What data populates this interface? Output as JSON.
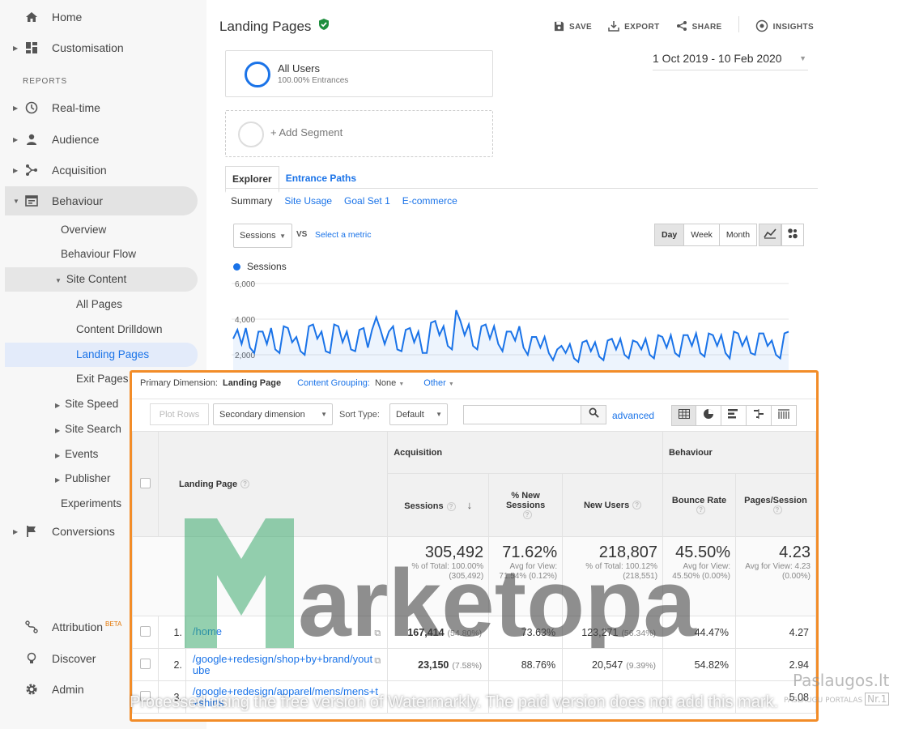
{
  "sidebar": {
    "items_top": [
      {
        "label": "Home",
        "icon": "home-icon"
      },
      {
        "label": "Customisation",
        "icon": "dashboard-icon"
      }
    ],
    "reports_label": "REPORTS",
    "items": [
      {
        "label": "Real-time",
        "icon": "clock-icon"
      },
      {
        "label": "Audience",
        "icon": "person-icon"
      },
      {
        "label": "Acquisition",
        "icon": "acquisition-icon"
      },
      {
        "label": "Behaviour",
        "icon": "behaviour-icon"
      }
    ],
    "behaviour_sub": [
      "Overview",
      "Behaviour Flow",
      "Site Content"
    ],
    "site_content_sub": [
      "All Pages",
      "Content Drilldown",
      "Landing Pages",
      "Exit Pages"
    ],
    "behaviour_more": [
      "Site Speed",
      "Site Search",
      "Events",
      "Publisher",
      "Experiments"
    ],
    "conversions": "Conversions",
    "bottom": [
      {
        "label": "Attribution",
        "badge": "BETA",
        "icon": "attribution-icon"
      },
      {
        "label": "Discover",
        "icon": "lightbulb-icon"
      },
      {
        "label": "Admin",
        "icon": "gear-icon"
      }
    ]
  },
  "header": {
    "title": "Landing Pages",
    "toolbar": {
      "save": "SAVE",
      "export": "EXPORT",
      "share": "SHARE",
      "insights": "INSIGHTS"
    }
  },
  "segments": {
    "current_name": "All Users",
    "current_sub": "100.00% Entrances",
    "add_label": "+ Add Segment"
  },
  "date_range": "1 Oct 2019 - 10 Feb 2020",
  "tabs": [
    "Explorer",
    "Entrance Paths"
  ],
  "subtabs": [
    "Summary",
    "Site Usage",
    "Goal Set 1",
    "E-commerce"
  ],
  "chart_controls": {
    "metric": "Sessions",
    "vs": "VS",
    "select_metric": "Select a metric",
    "periods": [
      "Day",
      "Week",
      "Month"
    ]
  },
  "chart_data": {
    "type": "line",
    "series": [
      {
        "name": "Sessions",
        "values": [
          2900,
          3400,
          2600,
          3500,
          2400,
          2100,
          3300,
          3300,
          2600,
          3500,
          2300,
          2100,
          3600,
          3500,
          2700,
          3000,
          2200,
          2000,
          3600,
          3700,
          2900,
          3300,
          2200,
          2100,
          3700,
          3600,
          2700,
          3300,
          2300,
          2200,
          3400,
          3500,
          2400,
          3400,
          4100,
          3400,
          2600,
          3300,
          3600,
          2300,
          2200,
          3400,
          3500,
          2700,
          3300,
          2100,
          2100,
          3800,
          3900,
          3100,
          3600,
          2500,
          2300,
          4500,
          3900,
          3100,
          3700,
          2500,
          2300,
          3600,
          3700,
          2900,
          3600,
          2600,
          2200,
          3300,
          3300,
          2800,
          3600,
          2400,
          2000,
          3000,
          3000,
          2400,
          3000,
          2100,
          1700,
          2300,
          2500,
          2100,
          2600,
          1800,
          1600,
          2700,
          2800,
          2200,
          2700,
          1900,
          1700,
          2800,
          2900,
          2300,
          2900,
          2000,
          1800,
          2800,
          2700,
          2300,
          2900,
          2000,
          1800,
          3100,
          3000,
          2400,
          3100,
          2100,
          1900,
          3100,
          3100,
          2500,
          3200,
          2100,
          1900,
          3200,
          3100,
          2500,
          3100,
          2100,
          1800,
          3300,
          3200,
          2500,
          3000,
          2100,
          2000,
          3200,
          3200,
          2500,
          2800,
          2000,
          1800,
          3200,
          3300
        ]
      }
    ],
    "y_ticks": [
      "6,000",
      "4,000",
      "2,000"
    ],
    "ylim": [
      0,
      6000
    ],
    "grid": true
  },
  "table": {
    "primary_dimension_label": "Primary Dimension:",
    "primary_dimension": "Landing Page",
    "content_grouping": "Content Grouping:",
    "content_grouping_value": "None",
    "other": "Other",
    "plot_rows": "Plot Rows",
    "secondary_dimension": "Secondary dimension",
    "sort_type_label": "Sort Type:",
    "sort_type": "Default",
    "search_value": "",
    "advanced": "advanced",
    "group_acq": "Acquisition",
    "group_beh": "Behaviour",
    "col_landing_page": "Landing Page",
    "columns": [
      "Sessions",
      "% New Sessions",
      "New Users",
      "Bounce Rate",
      "Pages/Session"
    ],
    "totals": {
      "sessions": "305,492",
      "sessions_sub": "% of Total: 100.00% (305,492)",
      "new_sessions": "71.62%",
      "new_sessions_sub": "Avg for View: 71.54% (0.12%)",
      "new_users": "218,807",
      "new_users_sub": "% of Total: 100.12% (218,551)",
      "bounce": "45.50%",
      "bounce_sub": "Avg for View: 45.50% (0.00%)",
      "pages": "4.23",
      "pages_sub": "Avg for View: 4.23 (0.00%)"
    },
    "rows": [
      {
        "idx": "1.",
        "page": "/home",
        "sessions": "167,414",
        "sessions_pct": "(54.80%)",
        "new_sessions": "73.63%",
        "new_users": "123,271",
        "new_users_pct": "(56.34%)",
        "bounce": "44.47%",
        "pages": "4.27"
      },
      {
        "idx": "2.",
        "page": "/google+redesign/shop+by+brand/youtube",
        "sessions": "23,150",
        "sessions_pct": "(7.58%)",
        "new_sessions": "88.76%",
        "new_users": "20,547",
        "new_users_pct": "(9.39%)",
        "bounce": "54.82%",
        "pages": "2.94"
      },
      {
        "idx": "3.",
        "page": "/google+redesign/apparel/mens/mens+t+shirts",
        "sessions": "",
        "sessions_pct": "",
        "new_sessions": "",
        "new_users": "",
        "new_users_pct": "",
        "bounce": "",
        "pages": "5.08"
      }
    ]
  },
  "watermarks": {
    "logo_text": "arketopa",
    "notice": "Processed using the free version of Watermarkly. The paid version does not add this mark.",
    "corner_brand": "Paslaugos.lt",
    "corner_sub": "PASLAUGU PORTALAS",
    "corner_rank": "Nr.1"
  }
}
